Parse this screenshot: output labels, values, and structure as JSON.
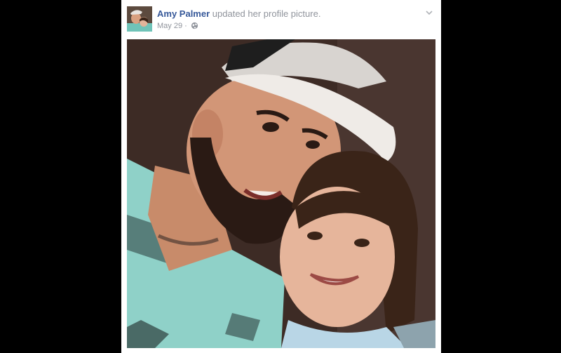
{
  "post": {
    "author_name": "Amy Palmer",
    "action_text": "updated her profile picture.",
    "date": "May 29",
    "separator": "·",
    "privacy_icon": "globe-icon",
    "menu_icon": "chevron-down-icon"
  },
  "colors": {
    "author_link": "#365899",
    "meta_text": "#90949c",
    "background": "#000000",
    "card": "#ffffff"
  }
}
